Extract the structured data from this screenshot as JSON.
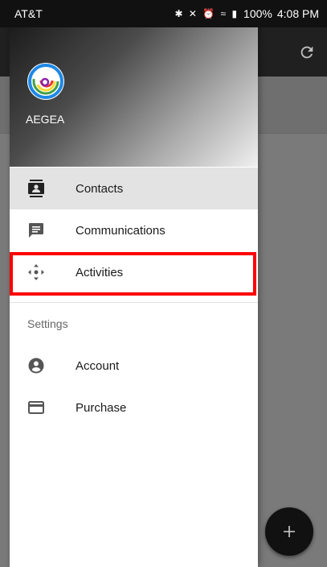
{
  "status_bar": {
    "carrier": "AT&T",
    "icons": "✱ ✕ ⏰ ≈ ▮",
    "battery": "100%",
    "time": "4:08 PM"
  },
  "drawer": {
    "brand": "AEGEA",
    "items": [
      {
        "label": "Contacts",
        "icon": "contacts-icon",
        "selected": true
      },
      {
        "label": "Communications",
        "icon": "message-icon",
        "selected": false
      },
      {
        "label": "Activities",
        "icon": "move-arrows-icon",
        "selected": false
      }
    ],
    "settings_header": "Settings",
    "settings_items": [
      {
        "label": "Account",
        "icon": "account-icon"
      },
      {
        "label": "Purchase",
        "icon": "credit-card-icon"
      }
    ]
  },
  "colors": {
    "highlight": "#ff0000",
    "selected_bg": "#e3e3e3",
    "icon": "#333333"
  }
}
